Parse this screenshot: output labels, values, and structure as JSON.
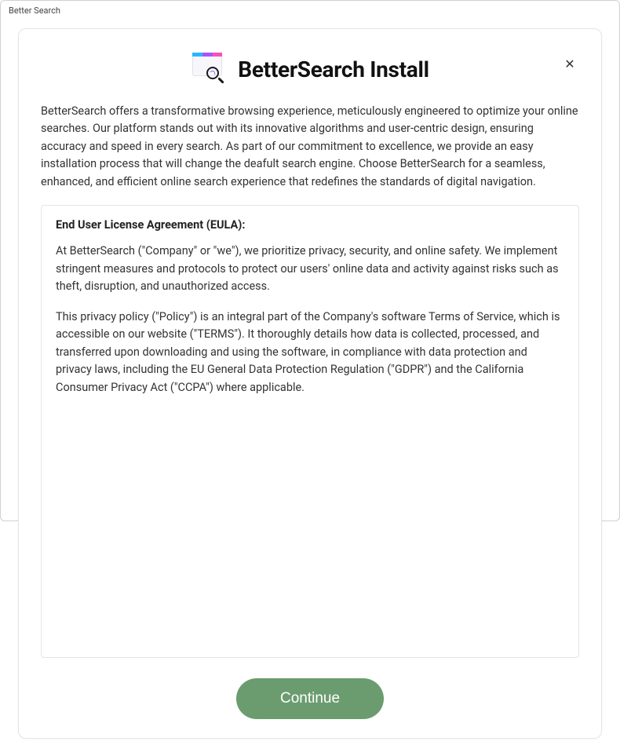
{
  "window": {
    "title": "Better Search"
  },
  "header": {
    "title": "BetterSearch Install",
    "close_glyph": "✕"
  },
  "intro": "BetterSearch offers a transformative browsing experience, meticulously engineered to optimize your online searches. Our platform stands out with its innovative algorithms and user-centric design, ensuring accuracy and speed in every search. As part of our commitment to excellence, we provide an easy installation process that will change the deafult search engine. Choose BetterSearch for a seamless, enhanced, and efficient online search experience that redefines the standards of digital navigation.",
  "eula": {
    "heading": "End User License Agreement (EULA):",
    "para1": "At BetterSearch (\"Company\" or \"we\"), we prioritize privacy, security, and online safety. We implement stringent measures and protocols to protect our users' online data and activity against risks such as theft, disruption, and unauthorized access.",
    "para2": "This privacy policy (\"Policy\") is an integral part of the Company's software Terms of Service, which is accessible on our website (\"TERMS\"). It thoroughly details how data is collected, processed, and transferred upon downloading and using the software, in compliance with data protection and privacy laws, including the EU General Data Protection Regulation (\"GDPR\") and the California Consumer Privacy Act (\"CCPA\") where applicable."
  },
  "buttons": {
    "continue_label": "Continue"
  },
  "colors": {
    "primary_button": "#6b9c6f"
  }
}
